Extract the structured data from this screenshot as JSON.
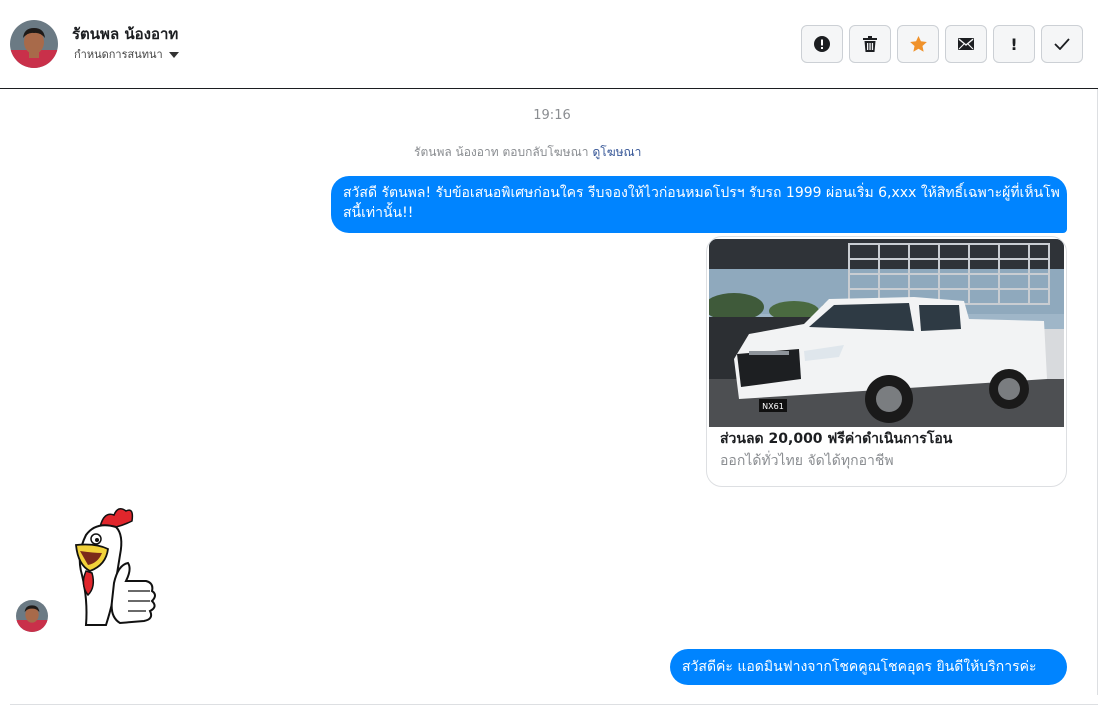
{
  "header": {
    "contact_name": "รัตนพล น้องอาท",
    "label_dropdown": "กำหนดการสนทนา",
    "actions": [
      {
        "name": "spam-button",
        "icon": "alert-circle-icon"
      },
      {
        "name": "delete-button",
        "icon": "trash-icon"
      },
      {
        "name": "star-button",
        "icon": "star-icon",
        "color": "#f0922b"
      },
      {
        "name": "mark-unread-button",
        "icon": "envelope-icon"
      },
      {
        "name": "follow-up-button",
        "icon": "exclamation-icon",
        "glyph": "!"
      },
      {
        "name": "mark-done-button",
        "icon": "checkmark-icon"
      }
    ]
  },
  "conversation": {
    "timestamp": "19:16",
    "reply_note": {
      "text": "รัตนพล น้องอาท ตอบกลับโฆษณา",
      "link": "ดูโฆษณา"
    },
    "messages": [
      {
        "type": "outgoing_text",
        "text": "สวัสดี รัตนพล! รับข้อเสนอพิเศษก่อนใคร รีบจองให้ไวก่อนหมดโปรฯ รับรถ 1999 ผ่อนเริ่ม 6,xxx ให้สิทธิ์เฉพาะผู้ที่เห็นโพสนี้เท่านั้น!!"
      },
      {
        "type": "ad_card",
        "title": "ส่วนลด 20,000 ฟรีค่าดำเนินการโอน",
        "subtitle": "ออกได้ทั่วไทย จัดได้ทุกอาชีพ",
        "image": "white-pickup-truck-image",
        "plate_text": "NX61"
      },
      {
        "type": "incoming_sticker",
        "sticker": "rooster-thumbs-up-sticker"
      },
      {
        "type": "outgoing_text",
        "text": "สวัสดีค่ะ แอดมินฟางจากโชคคูณโชคอุดร ยินดีให้บริการค่ะ"
      }
    ]
  },
  "colors": {
    "bubble": "#0084ff",
    "link": "#385898",
    "star": "#f0922b"
  }
}
